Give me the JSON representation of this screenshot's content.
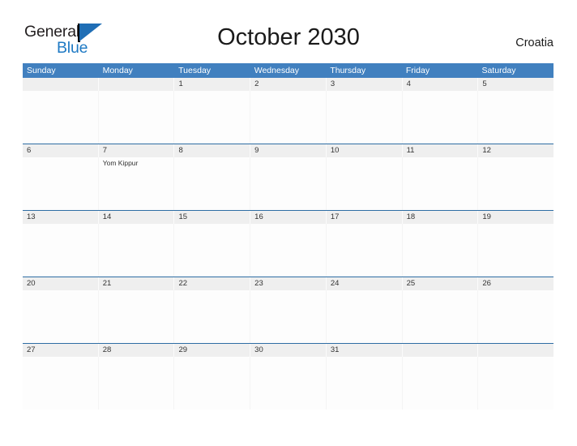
{
  "brand": {
    "name_part1": "General",
    "name_part2": "Blue",
    "color_primary": "#1f7ac4",
    "color_flag": "#1f6eb5"
  },
  "header": {
    "title": "October 2030",
    "country": "Croatia"
  },
  "theme": {
    "header_blue": "#4180bf",
    "row_rule_blue": "#2e6da4",
    "date_band_gray": "#efefef",
    "text_dark": "#333333"
  },
  "calendar": {
    "weekdays": [
      "Sunday",
      "Monday",
      "Tuesday",
      "Wednesday",
      "Thursday",
      "Friday",
      "Saturday"
    ],
    "weeks": [
      {
        "days": [
          {
            "number": "",
            "events": []
          },
          {
            "number": "",
            "events": []
          },
          {
            "number": "1",
            "events": []
          },
          {
            "number": "2",
            "events": []
          },
          {
            "number": "3",
            "events": []
          },
          {
            "number": "4",
            "events": []
          },
          {
            "number": "5",
            "events": []
          }
        ]
      },
      {
        "days": [
          {
            "number": "6",
            "events": []
          },
          {
            "number": "7",
            "events": [
              "Yom Kippur"
            ]
          },
          {
            "number": "8",
            "events": []
          },
          {
            "number": "9",
            "events": []
          },
          {
            "number": "10",
            "events": []
          },
          {
            "number": "11",
            "events": []
          },
          {
            "number": "12",
            "events": []
          }
        ]
      },
      {
        "days": [
          {
            "number": "13",
            "events": []
          },
          {
            "number": "14",
            "events": []
          },
          {
            "number": "15",
            "events": []
          },
          {
            "number": "16",
            "events": []
          },
          {
            "number": "17",
            "events": []
          },
          {
            "number": "18",
            "events": []
          },
          {
            "number": "19",
            "events": []
          }
        ]
      },
      {
        "days": [
          {
            "number": "20",
            "events": []
          },
          {
            "number": "21",
            "events": []
          },
          {
            "number": "22",
            "events": []
          },
          {
            "number": "23",
            "events": []
          },
          {
            "number": "24",
            "events": []
          },
          {
            "number": "25",
            "events": []
          },
          {
            "number": "26",
            "events": []
          }
        ]
      },
      {
        "days": [
          {
            "number": "27",
            "events": []
          },
          {
            "number": "28",
            "events": []
          },
          {
            "number": "29",
            "events": []
          },
          {
            "number": "30",
            "events": []
          },
          {
            "number": "31",
            "events": []
          },
          {
            "number": "",
            "events": []
          },
          {
            "number": "",
            "events": []
          }
        ]
      }
    ]
  }
}
